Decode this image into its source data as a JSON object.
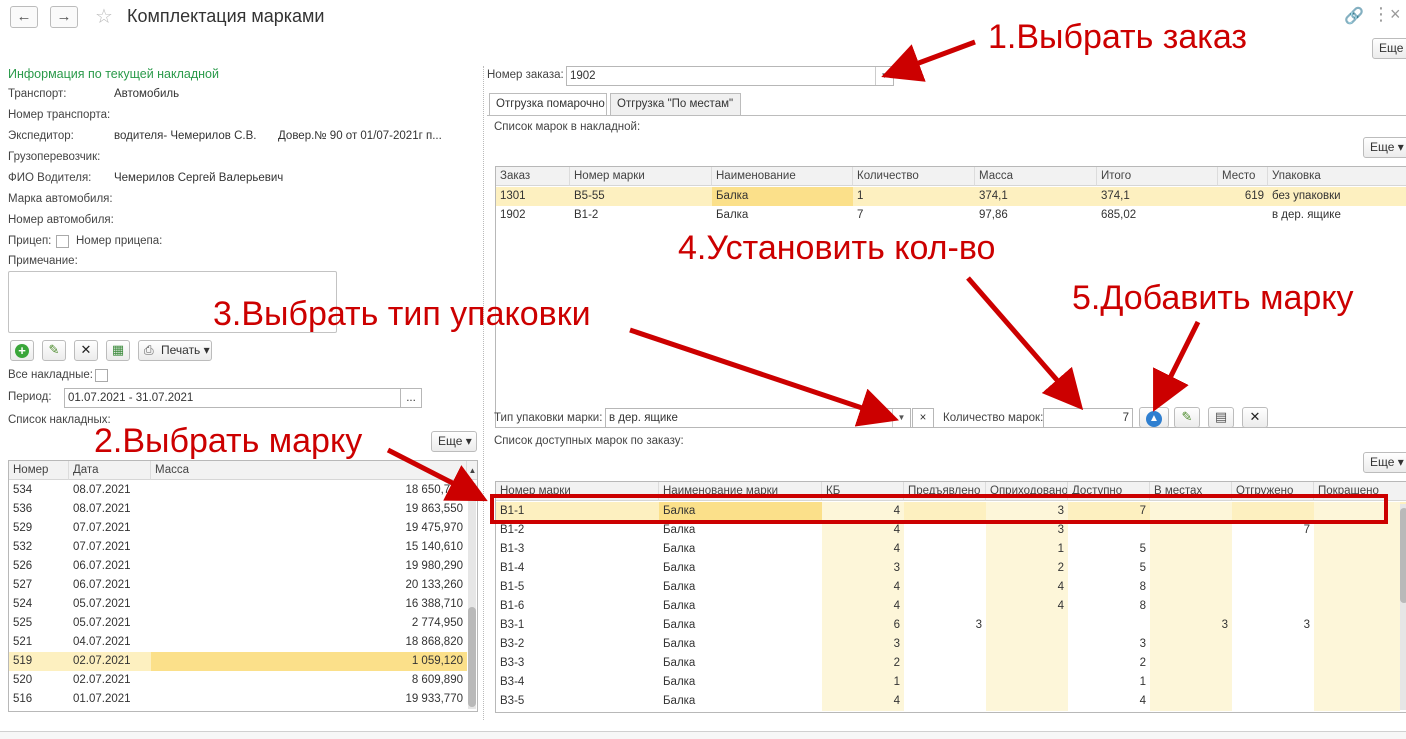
{
  "header": {
    "title": "Комплектация марками",
    "more_label": "Еще ▾"
  },
  "left": {
    "section_title": "Информация по текущей накладной",
    "fields": [
      {
        "label": "Транспорт:",
        "value": "Автомобиль"
      },
      {
        "label": "Номер транспорта:",
        "value": ""
      },
      {
        "label": "Экспедитор:",
        "value": "водителя- Чемерилов С.В.",
        "extra": "Довер.№ 90 от 01/07-2021г п..."
      },
      {
        "label": "Грузоперевозчик:",
        "value": ""
      },
      {
        "label": "ФИО Водителя:",
        "value": "Чемерилов Сергей Валерьевич"
      },
      {
        "label": "Марка автомобиля:",
        "value": ""
      },
      {
        "label": "Номер автомобиля:",
        "value": ""
      }
    ],
    "trailer_label": "Прицеп:",
    "trailer_number_label": "Номер прицепа:",
    "note_label": "Примечание:",
    "print_label": "Печать ▾",
    "all_invoices_label": "Все накладные:",
    "period_label": "Период:",
    "period_value": "01.07.2021 - 31.07.2021",
    "period_btn": "...",
    "list_label": "Список накладных:",
    "more_label": "Еще ▾",
    "invoices": {
      "columns": [
        "Номер",
        "Дата",
        "Масса"
      ],
      "rows": [
        [
          "534",
          "08.07.2021",
          "18 650,700"
        ],
        [
          "536",
          "08.07.2021",
          "19 863,550"
        ],
        [
          "529",
          "07.07.2021",
          "19 475,970"
        ],
        [
          "532",
          "07.07.2021",
          "15 140,610"
        ],
        [
          "526",
          "06.07.2021",
          "19 980,290"
        ],
        [
          "527",
          "06.07.2021",
          "20 133,260"
        ],
        [
          "524",
          "05.07.2021",
          "16 388,710"
        ],
        [
          "525",
          "05.07.2021",
          "2 774,950"
        ],
        [
          "521",
          "04.07.2021",
          "18 868,820"
        ],
        [
          "519",
          "02.07.2021",
          "1 059,120"
        ],
        [
          "520",
          "02.07.2021",
          "8 609,890"
        ],
        [
          "516",
          "01.07.2021",
          "19 933,770"
        ]
      ]
    }
  },
  "right": {
    "order_label": "Номер заказа:",
    "order_value": "1902",
    "tabs": [
      "Отгрузка помарочно",
      "Отгрузка \"По местам\""
    ],
    "marks_list_label": "Список марок в накладной:",
    "more_label": "Еще ▾",
    "marks": {
      "columns": [
        "Заказ",
        "Номер марки",
        "Наименование",
        "Количество",
        "Масса",
        "Итого",
        "Место",
        "Упаковка"
      ],
      "rows": [
        [
          "1301",
          "В5-55",
          "Балка",
          "1",
          "374,1",
          "374,1",
          "619",
          "без упаковки"
        ],
        [
          "1902",
          "В1-2",
          "Балка",
          "7",
          "97,86",
          "685,02",
          "",
          "в дер. ящике"
        ]
      ]
    },
    "pack_label": "Тип упаковки марки:",
    "pack_value": "в дер. ящике",
    "pack_clear": "×",
    "qty_label": "Количество марок:",
    "qty_value": "7",
    "available_label": "Список доступных марок по заказу:",
    "available": {
      "columns": [
        "Номер марки",
        "Наименование марки",
        "КБ",
        "Предъявлено",
        "Оприходовано",
        "Доступно",
        "В местах",
        "Отгружено",
        "Покрашено"
      ],
      "rows": [
        [
          "В1-1",
          "Балка",
          "4",
          "",
          "3",
          "7",
          "",
          "",
          ""
        ],
        [
          "В1-2",
          "Балка",
          "4",
          "",
          "3",
          "",
          "",
          "7",
          ""
        ],
        [
          "В1-3",
          "Балка",
          "4",
          "",
          "1",
          "5",
          "",
          "",
          ""
        ],
        [
          "В1-4",
          "Балка",
          "3",
          "",
          "2",
          "5",
          "",
          "",
          ""
        ],
        [
          "В1-5",
          "Балка",
          "4",
          "",
          "4",
          "8",
          "",
          "",
          ""
        ],
        [
          "В1-6",
          "Балка",
          "4",
          "",
          "4",
          "8",
          "",
          "",
          ""
        ],
        [
          "В3-1",
          "Балка",
          "6",
          "3",
          "",
          "",
          "3",
          "3",
          ""
        ],
        [
          "В3-2",
          "Балка",
          "3",
          "",
          "",
          "3",
          "",
          "",
          ""
        ],
        [
          "В3-3",
          "Балка",
          "2",
          "",
          "",
          "2",
          "",
          "",
          ""
        ],
        [
          "В3-4",
          "Балка",
          "1",
          "",
          "",
          "1",
          "",
          "",
          ""
        ],
        [
          "В3-5",
          "Балка",
          "4",
          "",
          "",
          "4",
          "",
          "",
          ""
        ]
      ]
    }
  },
  "annotations": {
    "step1": "1.Выбрать заказ",
    "step2": "2.Выбрать марку",
    "step3": "3.Выбрать тип упаковки",
    "step4": "4.Установить кол-во",
    "step5": "5.Добавить марку"
  },
  "colors": {
    "annotation": "#cc0000",
    "section_title": "#2a9a4a",
    "selection": "#fbe08a",
    "highlight_col": "#fdf6d9"
  }
}
